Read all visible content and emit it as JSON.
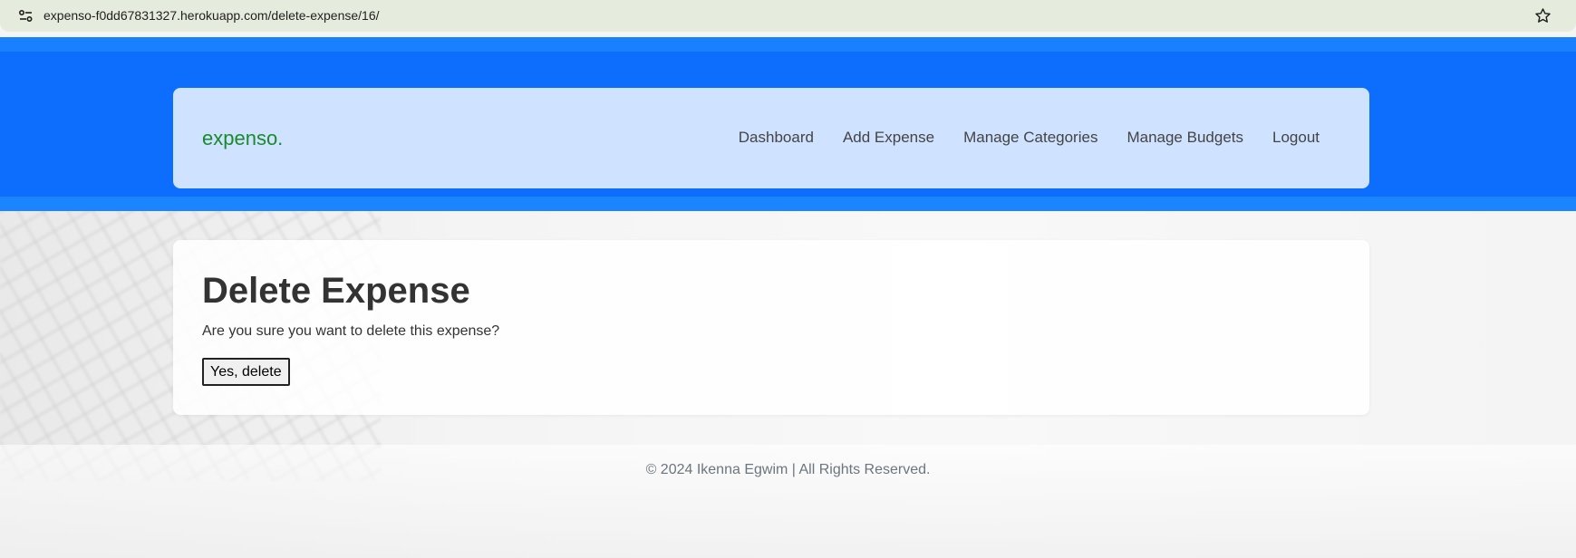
{
  "browser": {
    "url": "expenso-f0dd67831327.herokuapp.com/delete-expense/16/",
    "site_info_icon": "tune-icon",
    "bookmark_icon": "star-outline-icon"
  },
  "navbar": {
    "brand": "expenso.",
    "links": [
      {
        "label": "Dashboard"
      },
      {
        "label": "Add Expense"
      },
      {
        "label": "Manage Categories"
      },
      {
        "label": "Manage Budgets"
      },
      {
        "label": "Logout"
      }
    ]
  },
  "main": {
    "title": "Delete Expense",
    "message": "Are you sure you want to delete this expense?",
    "confirm_label": "Yes, delete"
  },
  "footer": {
    "text": "© 2024 Ikenna Egwim | All Rights Reserved."
  },
  "colors": {
    "header_blue": "#0d6efd",
    "navbar_bg": "#cfe2ff",
    "brand_green": "#1a8a2a",
    "address_bar": "#e6ecdd"
  }
}
